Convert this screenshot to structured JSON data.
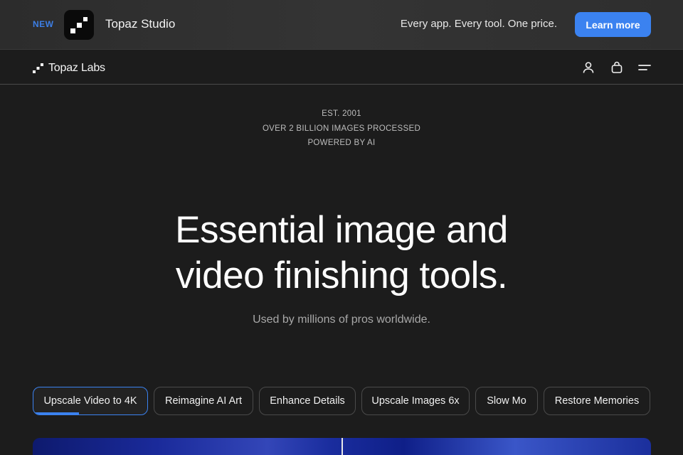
{
  "promo": {
    "badge": "NEW",
    "app_name": "Topaz Studio",
    "tagline": "Every app. Every tool. One price.",
    "cta_label": "Learn more"
  },
  "navbar": {
    "logo_text": "Topaz Labs",
    "icons": [
      "user-icon",
      "shopping-bag-icon",
      "menu-icon"
    ]
  },
  "hero": {
    "meta": [
      "EST. 2001",
      "OVER 2 BILLION IMAGES PROCESSED",
      "POWERED BY AI"
    ],
    "title_line1": "Essential image and",
    "title_line2": "video finishing tools.",
    "subtitle": "Used by millions of pros worldwide."
  },
  "tabs": [
    {
      "label": "Upscale Video to 4K",
      "active": true,
      "progress": 0.4
    },
    {
      "label": "Reimagine AI Art",
      "active": false
    },
    {
      "label": "Enhance Details",
      "active": false
    },
    {
      "label": "Upscale Images 6x",
      "active": false
    },
    {
      "label": "Slow Mo",
      "active": false
    },
    {
      "label": "Restore Memories",
      "active": false
    }
  ],
  "colors": {
    "accent": "#3b82f0",
    "background": "#1c1c1c",
    "promo_bg": "#303030"
  }
}
